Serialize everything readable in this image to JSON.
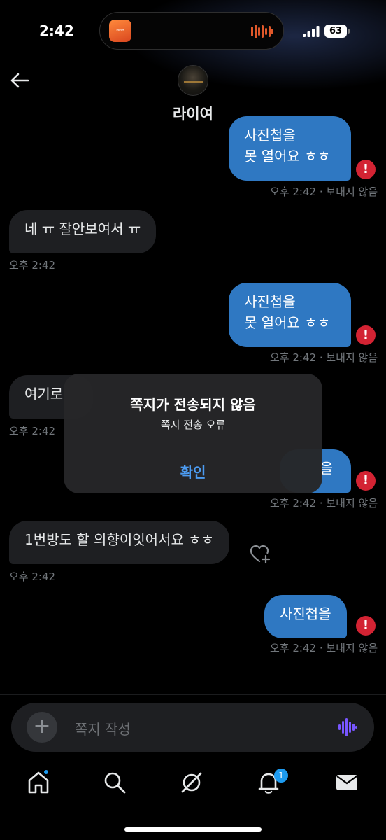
{
  "status_bar": {
    "time": "2:42",
    "battery": "63",
    "island_app_label": "ᴍᴍᴍ"
  },
  "header": {
    "title": "라이여",
    "back_icon": "arrow-left-icon"
  },
  "messages": [
    {
      "direction": "out",
      "lines": [
        "사진첩을",
        "못 열어요 ㅎㅎ"
      ],
      "time": "오후 2:42",
      "status": "· 보내지 않음",
      "error_icon": "!"
    },
    {
      "direction": "in",
      "text": "네 ㅠ 잘안보여서 ㅠ",
      "time": "오후 2:42"
    },
    {
      "direction": "out",
      "lines": [
        "사진첩을",
        "못 열어요 ㅎㅎ"
      ],
      "time": "오후 2:42",
      "status": "· 보내지 않음",
      "error_icon": "!"
    },
    {
      "direction": "in",
      "text": "여기로",
      "time": "오후 2:42"
    },
    {
      "direction": "out",
      "text": "을",
      "time": "오후 2:42",
      "status": "· 보내지 않음",
      "error_icon": "!"
    },
    {
      "direction": "in",
      "text": "1번방도 할 의향이잇어서요 ㅎㅎ",
      "time": "오후 2:42"
    },
    {
      "direction": "out",
      "text": "사진첩을",
      "time": "오후 2:42",
      "status": "· 보내지 않음",
      "error_icon": "!"
    }
  ],
  "dialog": {
    "title": "쪽지가 전송되지 않음",
    "message": "쪽지 전송 오류",
    "confirm": "확인"
  },
  "composer": {
    "placeholder": "쪽지 작성",
    "plus": "+"
  },
  "tabs": [
    {
      "name": "home",
      "icon": "home-icon",
      "badge": "dot"
    },
    {
      "name": "search",
      "icon": "search-icon"
    },
    {
      "name": "grok",
      "icon": "grok-icon"
    },
    {
      "name": "notifications",
      "icon": "bell-icon",
      "badge": "1"
    },
    {
      "name": "messages",
      "icon": "mail-icon"
    }
  ],
  "colors": {
    "accent": "#1d9bf0",
    "bubble_out": "#2f78c2",
    "bubble_in": "#1e1f22",
    "error": "#d32333",
    "background": "#000000"
  }
}
